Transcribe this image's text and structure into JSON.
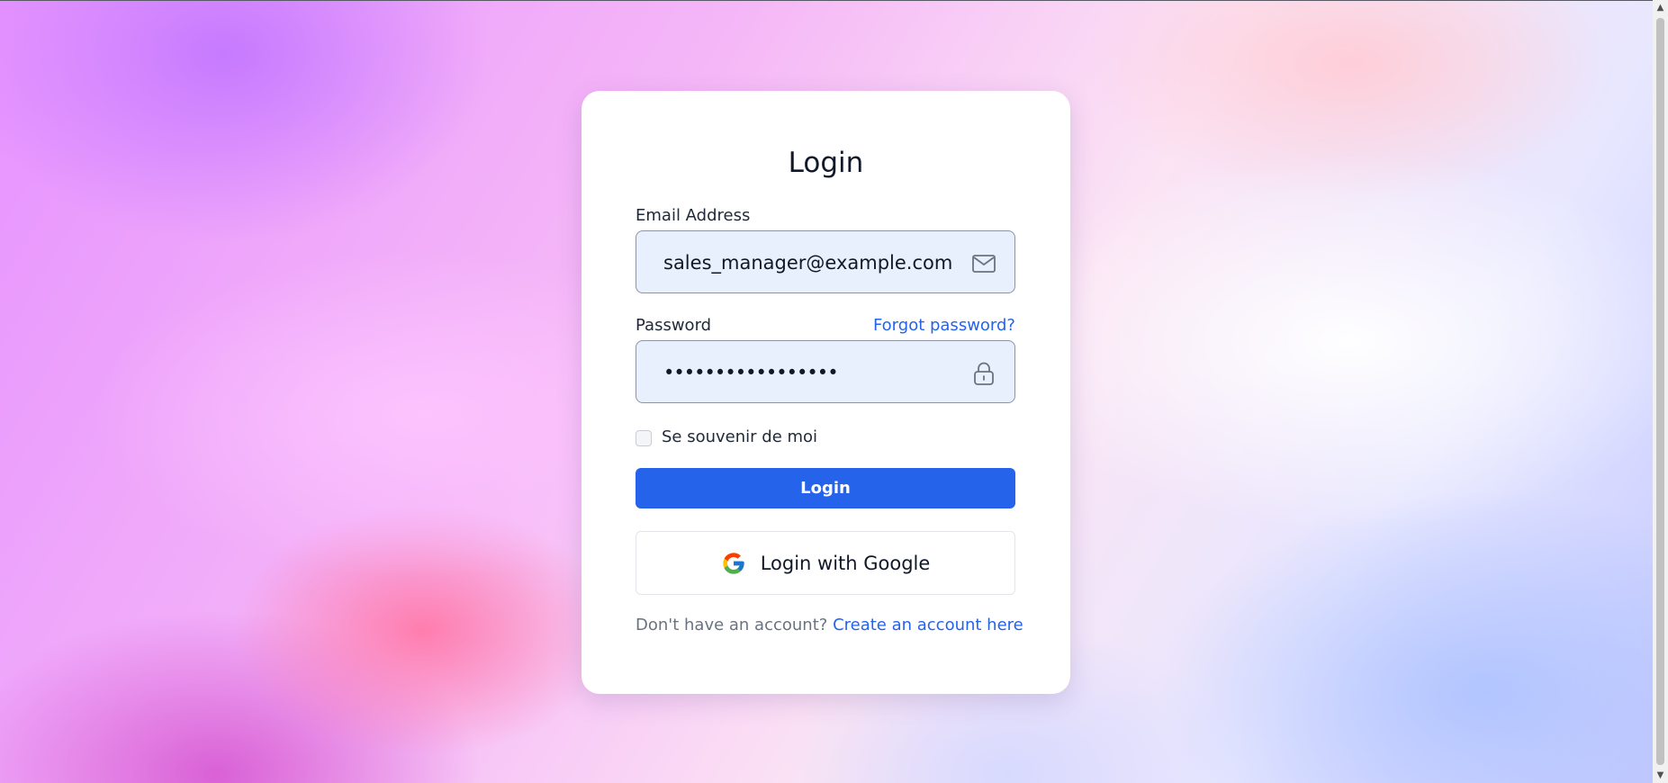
{
  "page": {
    "title": "Login"
  },
  "email": {
    "label": "Email Address",
    "value": "sales_manager@example.com",
    "icon": "mail-icon"
  },
  "password": {
    "label": "Password",
    "value": "•••••••••••••••••",
    "icon": "lock-icon",
    "forgot_link": "Forgot password?"
  },
  "remember": {
    "label": "Se souvenir de moi",
    "checked": false
  },
  "actions": {
    "login_label": "Login",
    "google_label": "Login with Google",
    "google_icon": "google-icon"
  },
  "footer": {
    "prompt": "Don't have an account?",
    "create_link": "Create an account here"
  },
  "colors": {
    "primary": "#2563eb",
    "field_bg": "#e8f0fe",
    "text": "#111827",
    "muted": "#6b7280"
  }
}
